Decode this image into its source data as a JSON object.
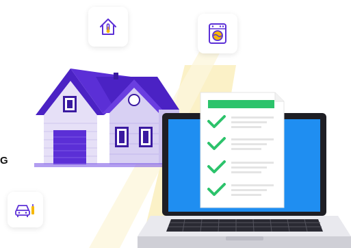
{
  "fragment_text": "G",
  "colors": {
    "background": "#ffffff",
    "beam": "#fbf1c7",
    "house_purple": "#5b2fd6",
    "house_wall": "#e6e0f7",
    "screen_blue": "#1f8ef1",
    "laptop_dark": "#1e1e24",
    "check_green": "#2cc36b",
    "doc_line": "#e4e4e4",
    "icon_stroke": "#5b2fd6",
    "icon_accent": "#f5b800"
  },
  "icons": {
    "top_left_card": "house-thermometer-icon",
    "top_right_card": "washing-machine-icon",
    "bottom_left_card": "car-charging-icon"
  },
  "checklist": {
    "items": 4,
    "all_checked": true
  }
}
